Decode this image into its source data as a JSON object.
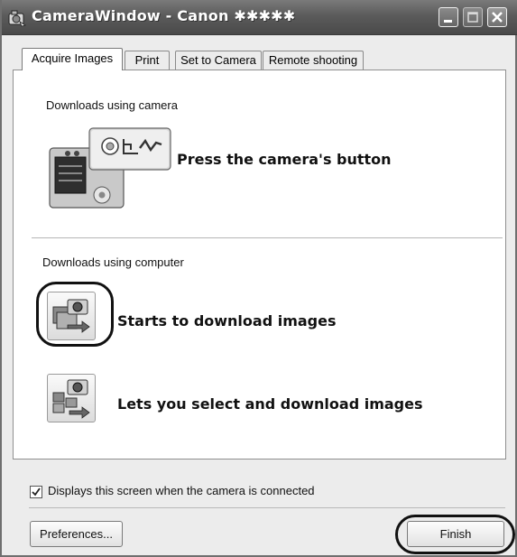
{
  "window": {
    "title": "CameraWindow - Canon ✱✱✱✱✱",
    "controls": [
      "minimize",
      "maximize",
      "close"
    ]
  },
  "tabs": [
    {
      "label": "Acquire Images",
      "active": true
    },
    {
      "label": "Print",
      "active": false
    },
    {
      "label": "Set to Camera",
      "active": false
    },
    {
      "label": "Remote shooting",
      "active": false
    }
  ],
  "camera_section": {
    "label": "Downloads using camera",
    "action_text": "Press the camera's button",
    "icon": "camera-button-illustration-icon"
  },
  "computer_section": {
    "label": "Downloads using computer",
    "items": [
      {
        "text": "Starts to download images",
        "icon": "download-images-icon",
        "highlighted": true
      },
      {
        "text": "Lets you select and download images",
        "icon": "select-download-images-icon",
        "highlighted": false
      }
    ]
  },
  "footer": {
    "checkbox_label": "Displays this screen when the camera is connected",
    "checkbox_checked": true,
    "preferences_label": "Preferences...",
    "finish_label": "Finish"
  }
}
